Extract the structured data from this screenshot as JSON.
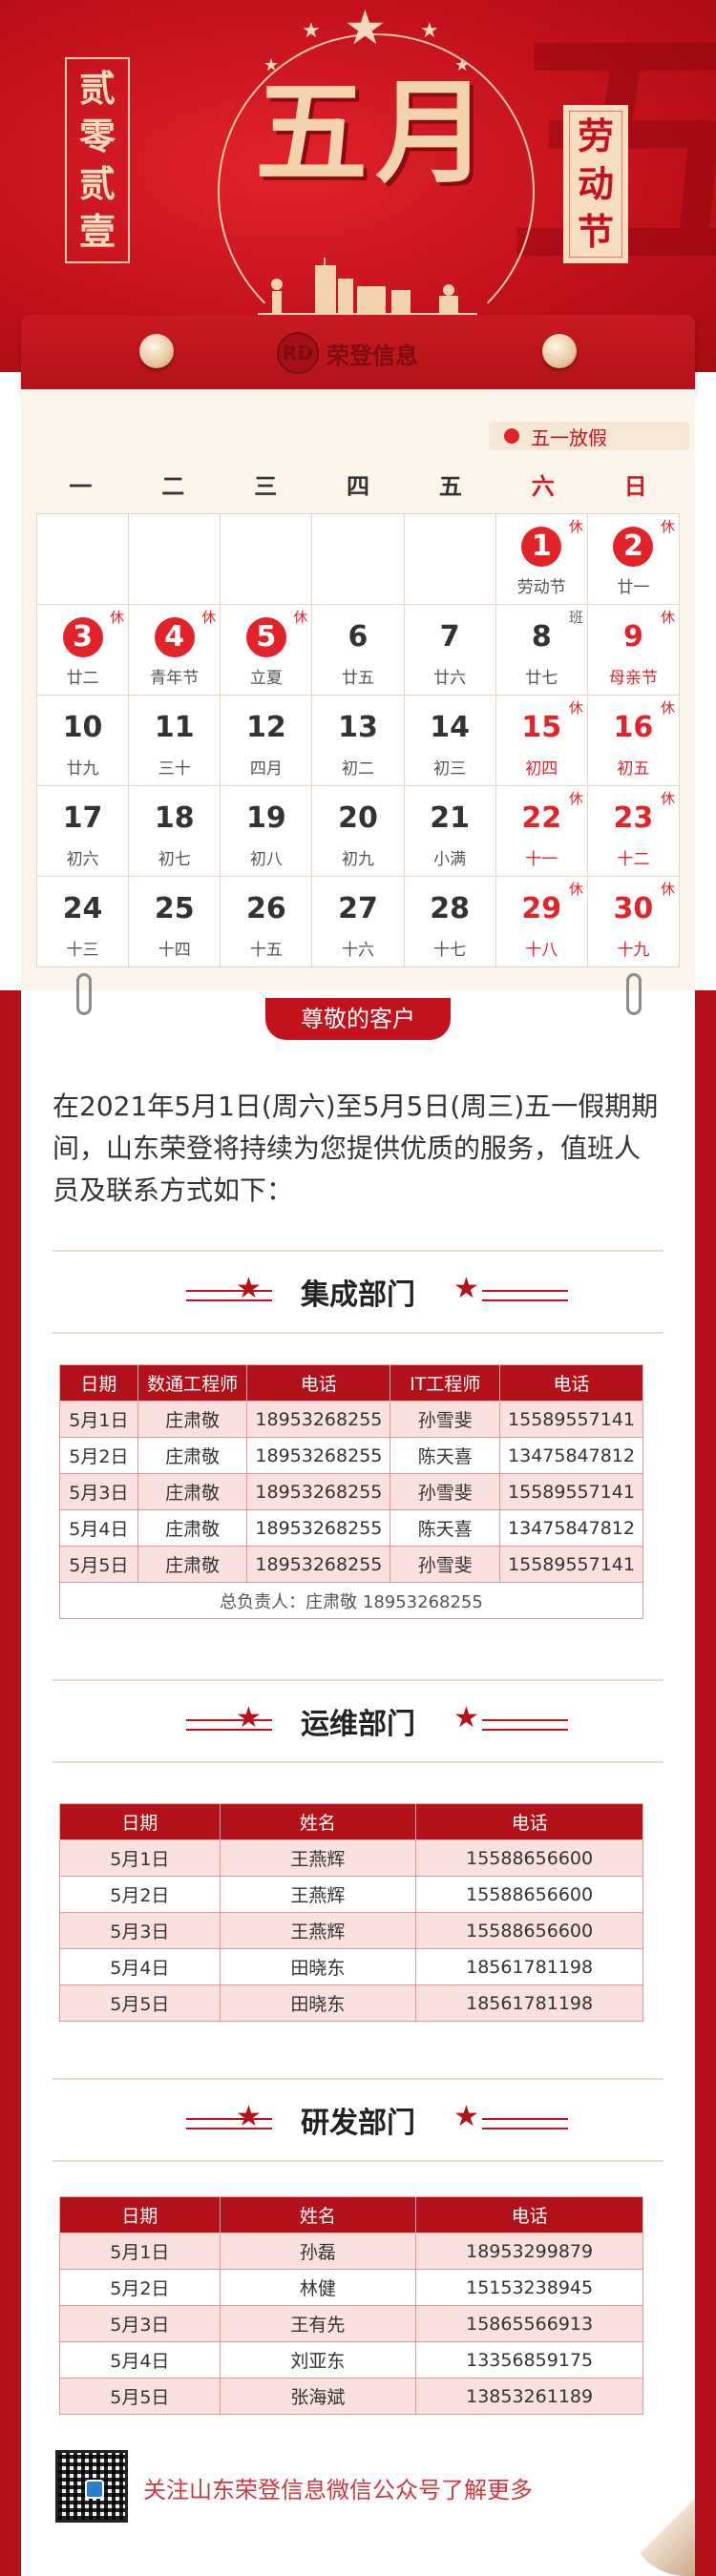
{
  "hero": {
    "left_vertical": [
      "贰",
      "零",
      "贰",
      "壹"
    ],
    "title": "五月",
    "right_vertical": [
      "劳",
      "动",
      "节"
    ],
    "bg_char": "五"
  },
  "brand": {
    "mark": "RD",
    "name": "荣登信息"
  },
  "calendar": {
    "legend": "五一放假",
    "weekdays": [
      "一",
      "二",
      "三",
      "四",
      "五",
      "六",
      "日"
    ],
    "cells": [
      {
        "d": "",
        "s": ""
      },
      {
        "d": "",
        "s": ""
      },
      {
        "d": "",
        "s": ""
      },
      {
        "d": "",
        "s": ""
      },
      {
        "d": "",
        "s": ""
      },
      {
        "d": "1",
        "s": "劳动节",
        "tag": "休",
        "circle": true
      },
      {
        "d": "2",
        "s": "廿一",
        "tag": "休",
        "circle": true
      },
      {
        "d": "3",
        "s": "廿二",
        "tag": "休",
        "circle": true
      },
      {
        "d": "4",
        "s": "青年节",
        "tag": "休",
        "circle": true
      },
      {
        "d": "5",
        "s": "立夏",
        "tag": "休",
        "circle": true
      },
      {
        "d": "6",
        "s": "廿五"
      },
      {
        "d": "7",
        "s": "廿六"
      },
      {
        "d": "8",
        "s": "廿七",
        "tag": "班",
        "ban": true
      },
      {
        "d": "9",
        "s": "母亲节",
        "tag": "休",
        "red": true
      },
      {
        "d": "10",
        "s": "廿九"
      },
      {
        "d": "11",
        "s": "三十"
      },
      {
        "d": "12",
        "s": "四月"
      },
      {
        "d": "13",
        "s": "初二"
      },
      {
        "d": "14",
        "s": "初三"
      },
      {
        "d": "15",
        "s": "初四",
        "tag": "休",
        "red": true
      },
      {
        "d": "16",
        "s": "初五",
        "tag": "休",
        "red": true
      },
      {
        "d": "17",
        "s": "初六"
      },
      {
        "d": "18",
        "s": "初七"
      },
      {
        "d": "19",
        "s": "初八"
      },
      {
        "d": "20",
        "s": "初九"
      },
      {
        "d": "21",
        "s": "小满"
      },
      {
        "d": "22",
        "s": "十一",
        "tag": "休",
        "red": true
      },
      {
        "d": "23",
        "s": "十二",
        "tag": "休",
        "red": true
      },
      {
        "d": "24",
        "s": "十三"
      },
      {
        "d": "25",
        "s": "十四"
      },
      {
        "d": "26",
        "s": "十五"
      },
      {
        "d": "27",
        "s": "十六"
      },
      {
        "d": "28",
        "s": "十七"
      },
      {
        "d": "29",
        "s": "十八",
        "tag": "休",
        "red": true
      },
      {
        "d": "30",
        "s": "十九",
        "tag": "休",
        "red": true
      }
    ]
  },
  "customer_label": "尊敬的客户",
  "intro": "在2021年5月1日(周六)至5月5日(周三)五一假期期间，山东荣登将持续为您提供优质的服务，值班人员及联系方式如下：",
  "integration": {
    "title": "集成部门",
    "headers": [
      "日期",
      "数通工程师",
      "电话",
      "IT工程师",
      "电话"
    ],
    "rows": [
      [
        "5月1日",
        "庄肃敬",
        "18953268255",
        "孙雪斐",
        "15589557141"
      ],
      [
        "5月2日",
        "庄肃敬",
        "18953268255",
        "陈天喜",
        "13475847812"
      ],
      [
        "5月3日",
        "庄肃敬",
        "18953268255",
        "孙雪斐",
        "15589557141"
      ],
      [
        "5月4日",
        "庄肃敬",
        "18953268255",
        "陈天喜",
        "13475847812"
      ],
      [
        "5月5日",
        "庄肃敬",
        "18953268255",
        "孙雪斐",
        "15589557141"
      ]
    ],
    "total": "总负责人：庄肃敬 18953268255"
  },
  "ops": {
    "title": "运维部门",
    "headers": [
      "日期",
      "姓名",
      "电话"
    ],
    "rows": [
      [
        "5月1日",
        "王燕辉",
        "15588656600"
      ],
      [
        "5月2日",
        "王燕辉",
        "15588656600"
      ],
      [
        "5月3日",
        "王燕辉",
        "15588656600"
      ],
      [
        "5月4日",
        "田晓东",
        "18561781198"
      ],
      [
        "5月5日",
        "田晓东",
        "18561781198"
      ]
    ]
  },
  "rnd": {
    "title": "研发部门",
    "headers": [
      "日期",
      "姓名",
      "电话"
    ],
    "rows": [
      [
        "5月1日",
        "孙磊",
        "18953299879"
      ],
      [
        "5月2日",
        "林健",
        "15153238945"
      ],
      [
        "5月3日",
        "王有先",
        "15865566913"
      ],
      [
        "5月4日",
        "刘亚东",
        "13356859175"
      ],
      [
        "5月5日",
        "张海斌",
        "13853261189"
      ]
    ]
  },
  "footer": {
    "follow_text": "关注山东荣登信息微信公众号了解更多"
  },
  "colors": {
    "primary": "#c4121c",
    "dark_red": "#b3121a",
    "holiday_red": "#e32229",
    "gold": "#f3d2ae",
    "paper": "#fbf4ea"
  }
}
